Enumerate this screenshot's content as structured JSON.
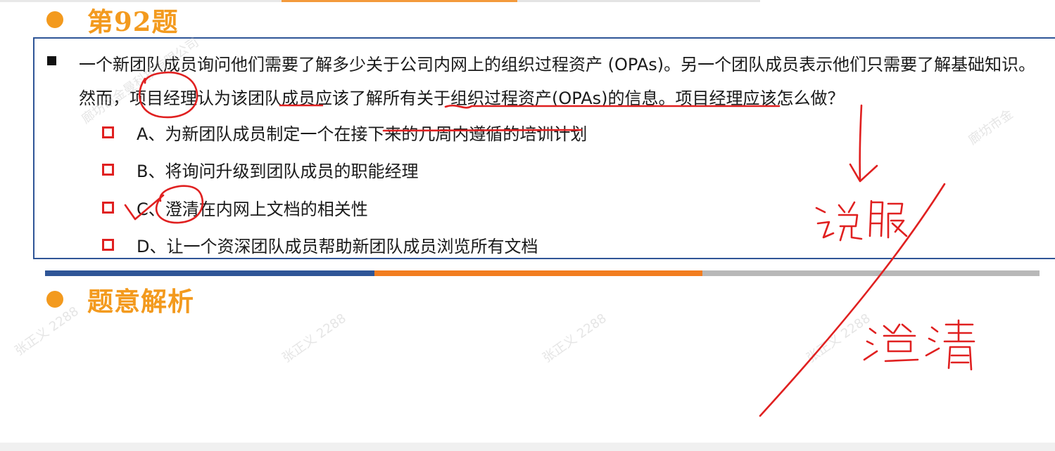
{
  "question_heading": "第92题",
  "question": {
    "text": "一个新团队成员询问他们需要了解多少关于公司内网上的组织过程资产 (OPAs)。另一个团队成员表示他们只需要了解基础知识。然而，项目经理认为该团队成员应该了解所有关于组织过程资产(OPAs)的信息。项目经理应该怎么做？"
  },
  "options": [
    {
      "label": "A、为新团队成员制定一个在接下来的几周内遵循的培训计划"
    },
    {
      "label": "B、将询问升级到团队成员的职能经理"
    },
    {
      "label": "C、澄清在内网上文档的相关性"
    },
    {
      "label": "D、让一个资深团队成员帮助新团队成员浏览所有文档"
    }
  ],
  "analysis_heading": "题意解析",
  "watermarks": [
    "廊坊市金曼科技有限公司",
    "廊坊市金",
    "张正义 2288",
    "张正义 2288",
    "张正义 2288",
    "张正义 2288"
  ],
  "colors": {
    "accent_orange": "#f39a1e",
    "box_border_blue": "#2f5597",
    "option_marker_red": "#e02020",
    "ink_red": "#e02020"
  }
}
